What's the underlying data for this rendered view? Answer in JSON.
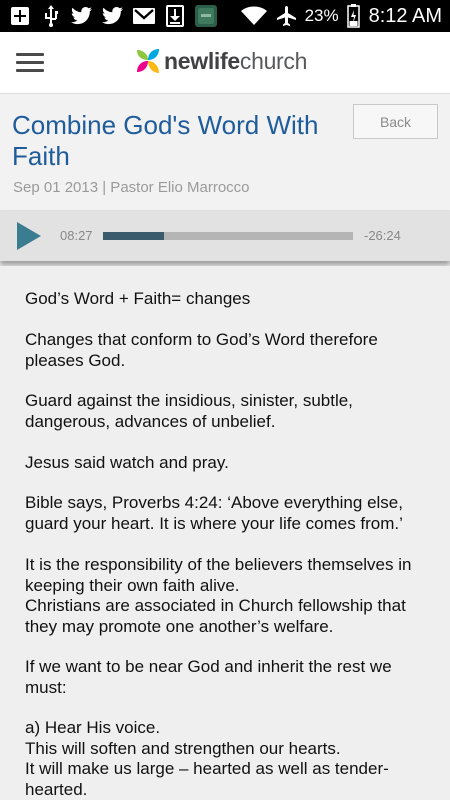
{
  "status_bar": {
    "icons_left": [
      "add-box-icon",
      "usb-icon",
      "twitter-icon",
      "twitter-icon",
      "gmail-icon",
      "download-icon",
      "app-thumbnail-icon"
    ],
    "icons_right": [
      "wifi-icon",
      "airplane-mode-icon",
      "battery-icon"
    ],
    "battery": "23%",
    "time": "8:12 AM"
  },
  "header": {
    "logo_bold": "newlife",
    "logo_light": "church"
  },
  "sermon": {
    "title": "Combine God's Word With Faith",
    "meta": "Sep 01 2013 | Pastor Elio Marrocco",
    "back_label": "Back"
  },
  "player": {
    "elapsed": "08:27",
    "remaining": "-26:24",
    "progress": 0.245
  },
  "body": {
    "paragraphs": [
      "God’s Word + Faith= changes",
      "Changes that conform to God’s Word therefore pleases God.",
      "Guard against the insidious, sinister, subtle, dangerous, advances of unbelief.",
      "Jesus said watch and pray.",
      "Bible says, Proverbs 4:24: ‘Above everything else, guard your heart. It is where your life comes from.’",
      "It is the responsibility of the believers themselves in keeping their own faith alive.",
      "Christians are associated in Church fellowship that they may promote one another’s welfare.",
      "If we want to be near God and inherit the rest we must:",
      "a) Hear His voice.",
      "This will soften and strengthen our hearts.",
      "It will make us large – hearted as well as tender-hearted."
    ]
  },
  "colors": {
    "title": "#1f5c9c",
    "play": "#3a7d91",
    "progress_fill": "#3a5b6b"
  }
}
